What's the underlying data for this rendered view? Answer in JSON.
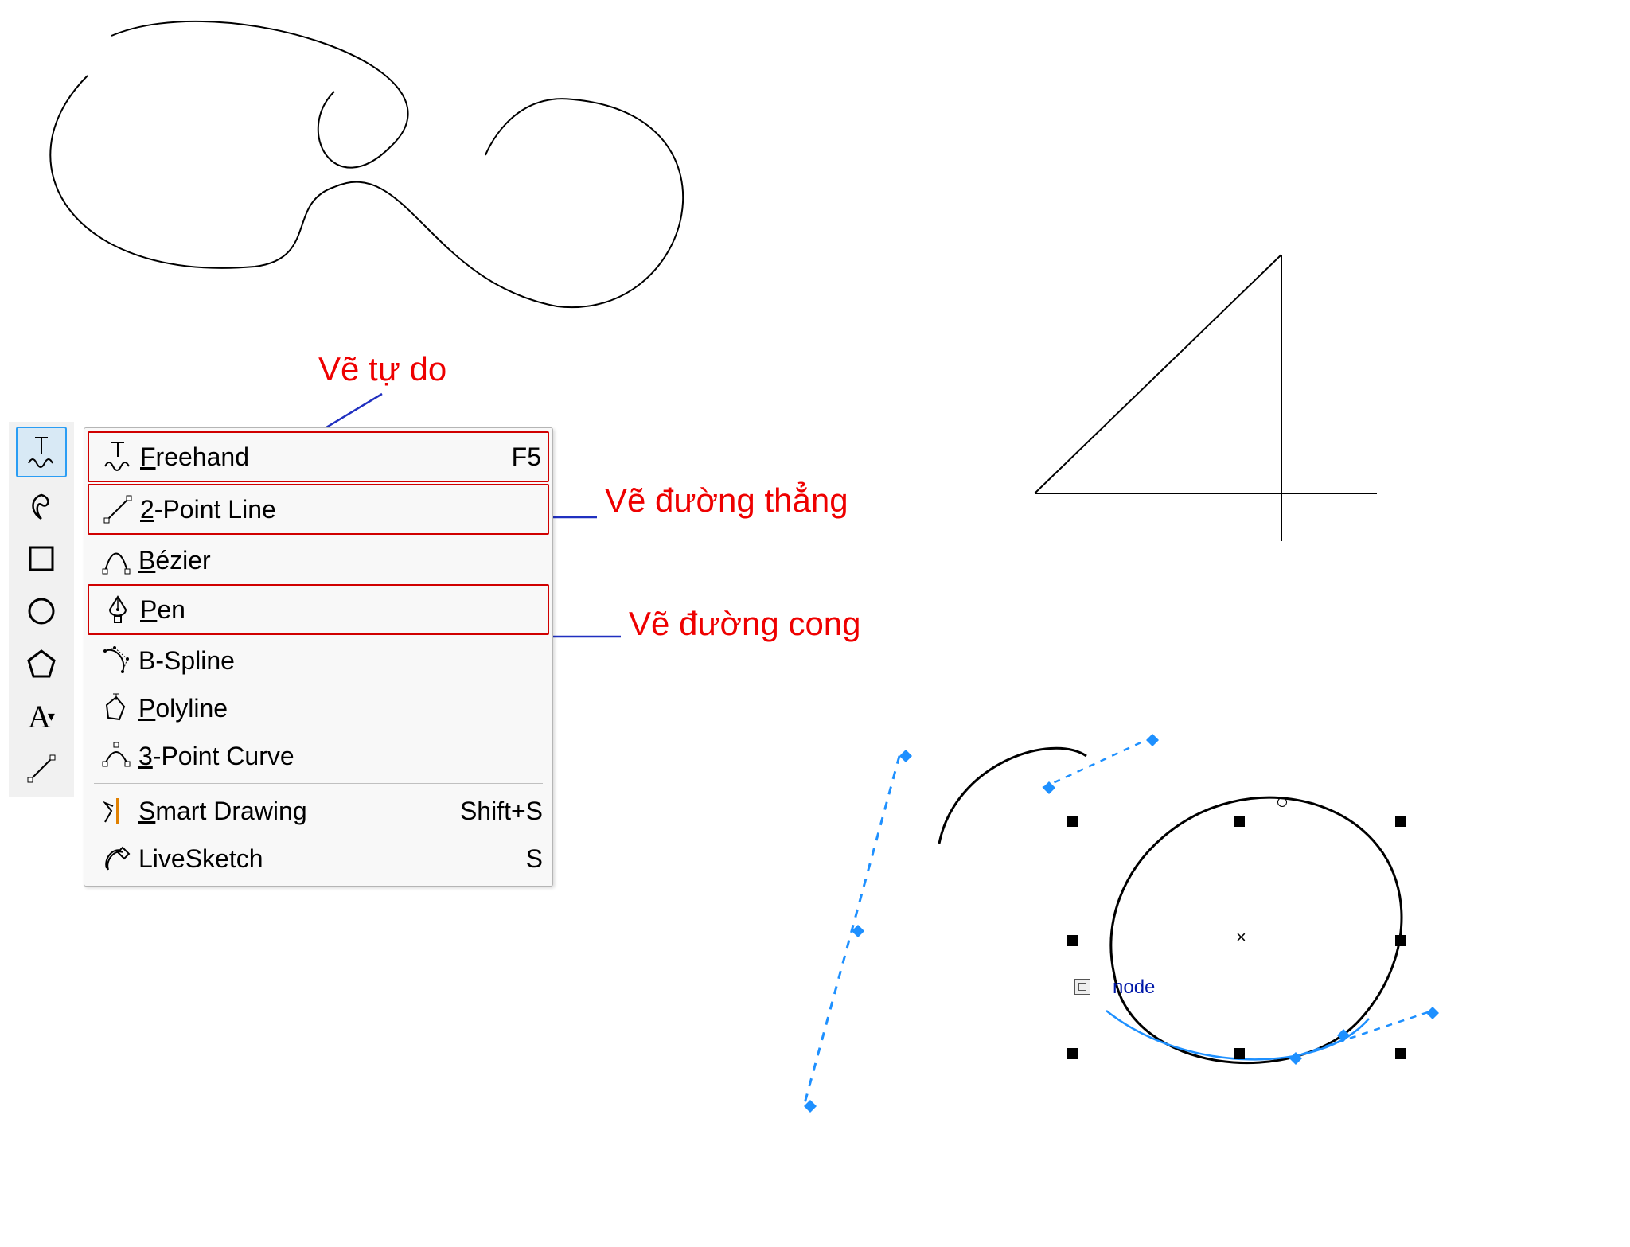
{
  "annotations": {
    "freehand": "Vẽ tự do",
    "line": "Vẽ đường thẳng",
    "curve": "Vẽ đường cong"
  },
  "node_label": "node",
  "toolbox": {
    "items": [
      {
        "name": "freehand-tool",
        "icon": "freehand",
        "selected": true
      },
      {
        "name": "smear-tool",
        "icon": "smear",
        "selected": false
      },
      {
        "name": "rectangle-tool",
        "icon": "rectangle",
        "selected": false
      },
      {
        "name": "ellipse-tool",
        "icon": "ellipse",
        "selected": false
      },
      {
        "name": "polygon-tool",
        "icon": "polygon",
        "selected": false
      },
      {
        "name": "text-tool",
        "icon": "text",
        "selected": false
      },
      {
        "name": "dimension-tool",
        "icon": "dimension",
        "selected": false
      }
    ]
  },
  "flyout": {
    "items": [
      {
        "name": "freehand",
        "icon": "freehand",
        "label": "Freehand",
        "u": "F",
        "shortcut": "F5",
        "boxed": true,
        "sep": false
      },
      {
        "name": "2pt-line",
        "icon": "line2pt",
        "label": "2-Point Line",
        "u": "2",
        "shortcut": "",
        "boxed": true,
        "sep": false
      },
      {
        "name": "bezier",
        "icon": "bezier",
        "label": "Bézier",
        "u": "B",
        "shortcut": "",
        "boxed": false,
        "sep": false
      },
      {
        "name": "pen",
        "icon": "pen",
        "label": "Pen",
        "u": "P",
        "shortcut": "",
        "boxed": true,
        "sep": false
      },
      {
        "name": "bspline",
        "icon": "bspline",
        "label": "B-Spline",
        "u": "",
        "shortcut": "",
        "boxed": false,
        "sep": false
      },
      {
        "name": "polyline",
        "icon": "polyline",
        "label": "Polyline",
        "u": "P",
        "shortcut": "",
        "boxed": false,
        "sep": false
      },
      {
        "name": "3pt-curve",
        "icon": "curve3pt",
        "label": "3-Point Curve",
        "u": "3",
        "shortcut": "",
        "boxed": false,
        "sep": true
      },
      {
        "name": "smart-drawing",
        "icon": "smartdraw",
        "label": "Smart Drawing",
        "u": "S",
        "shortcut": "Shift+S",
        "boxed": false,
        "sep": false
      },
      {
        "name": "livesketch",
        "icon": "livesketch",
        "label": "LiveSketch",
        "u": "",
        "shortcut": "S",
        "boxed": false,
        "sep": false
      }
    ]
  },
  "colors": {
    "annotation": "#ee0000",
    "arrow": "#2030c0",
    "guide": "#1e90ff"
  }
}
